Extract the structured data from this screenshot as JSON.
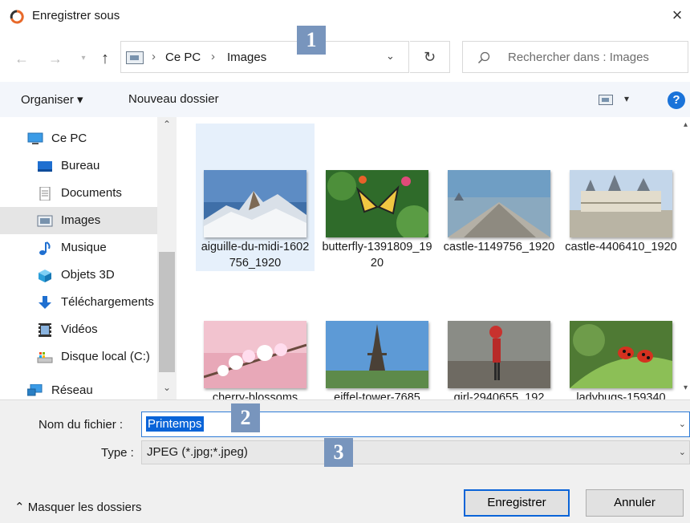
{
  "window": {
    "title": "Enregistrer sous",
    "close": "×"
  },
  "nav": {
    "back": "←",
    "forward": "→",
    "recent": "▾",
    "up": "↑",
    "breadcrumbs": [
      "Ce PC",
      "Images"
    ],
    "separator": "›",
    "address_dropdown": "⌄",
    "refresh": "↻",
    "search_placeholder": "Rechercher dans : Images"
  },
  "toolbar": {
    "organise": "Organiser ▾",
    "new_folder": "Nouveau dossier",
    "view_dropdown": "▾",
    "help": "?"
  },
  "sidebar": {
    "items": [
      {
        "label": "Ce PC",
        "icon": "computer-icon",
        "level": 0
      },
      {
        "label": "Bureau",
        "icon": "desktop-icon",
        "level": 1
      },
      {
        "label": "Documents",
        "icon": "document-icon",
        "level": 1
      },
      {
        "label": "Images",
        "icon": "pictures-icon",
        "level": 1,
        "selected": true
      },
      {
        "label": "Musique",
        "icon": "music-icon",
        "level": 1
      },
      {
        "label": "Objets 3D",
        "icon": "cube-icon",
        "level": 1
      },
      {
        "label": "Téléchargements",
        "icon": "download-icon",
        "level": 1
      },
      {
        "label": "Vidéos",
        "icon": "video-icon",
        "level": 1
      },
      {
        "label": "Disque local (C:)",
        "icon": "drive-icon",
        "level": 1
      },
      {
        "label": "Réseau",
        "icon": "network-icon",
        "level": 0
      }
    ],
    "scroll_up": "⌃",
    "scroll_down": "⌄"
  },
  "files": [
    {
      "name": "aiguille-du-midi-1602756_1920",
      "selected": true
    },
    {
      "name": "butterfly-1391809_1920"
    },
    {
      "name": "castle-1149756_1920"
    },
    {
      "name": "castle-4406410_1920"
    },
    {
      "name": "cherry-blossoms"
    },
    {
      "name": "eiffel-tower-7685"
    },
    {
      "name": "girl-2940655_192"
    },
    {
      "name": "ladybugs-159340"
    }
  ],
  "grid_scroll": {
    "up": "▴",
    "down": "▾"
  },
  "form": {
    "filename_label": "Nom du fichier :",
    "filename_value": "Printemps",
    "type_label": "Type :",
    "type_value": "JPEG (*.jpg;*.jpeg)",
    "dropdown": "⌄",
    "hide_folders": "⌃  Masquer les dossiers",
    "save": "Enregistrer",
    "cancel": "Annuler"
  },
  "annotations": [
    "1",
    "2",
    "3"
  ],
  "colors": {
    "accent": "#0a64d8",
    "badge": "#7895bd",
    "selection": "#e6f0fb",
    "toolbar": "#f3f6fb"
  }
}
